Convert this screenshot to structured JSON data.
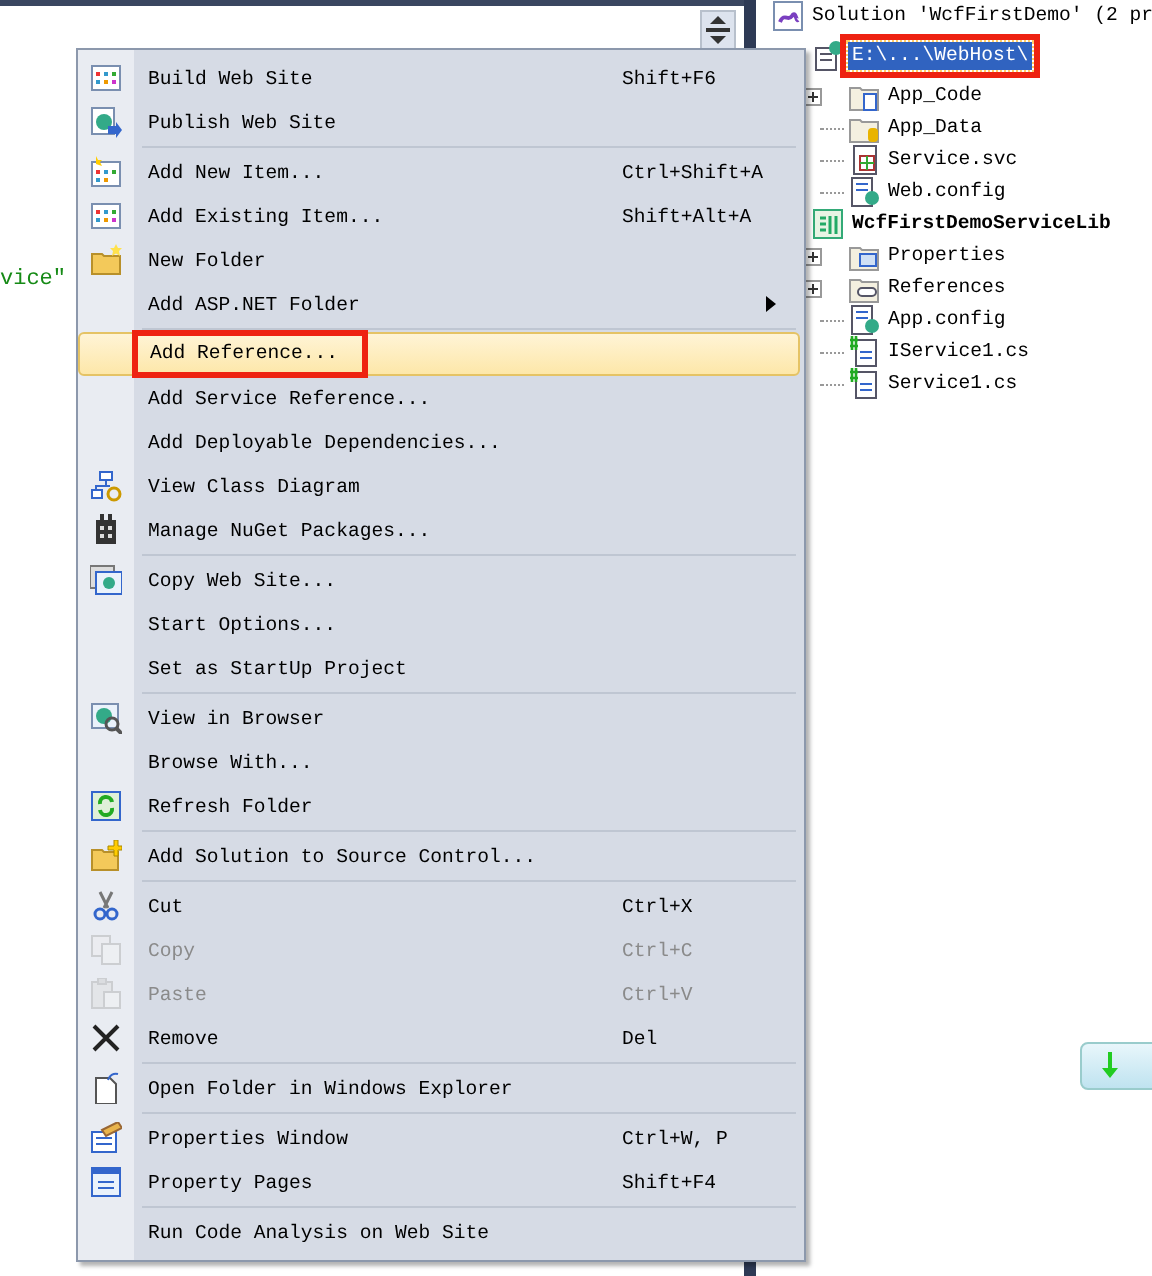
{
  "editor": {
    "code_fragment": "vice\""
  },
  "context_menu": {
    "groups": [
      [
        {
          "label": "Build Web Site",
          "shortcut": "Shift+F6",
          "disabled": false,
          "selected": false
        },
        {
          "label": "Publish Web Site",
          "disabled": false,
          "selected": false
        }
      ],
      [
        {
          "label": "Add New Item...",
          "shortcut": "Ctrl+Shift+A",
          "disabled": false,
          "selected": false
        },
        {
          "label": "Add Existing Item...",
          "shortcut": "Shift+Alt+A",
          "disabled": false,
          "selected": false
        },
        {
          "label": "New Folder",
          "disabled": false,
          "selected": false
        },
        {
          "label": "Add ASP.NET Folder",
          "disabled": false,
          "selected": false,
          "submenu": true
        }
      ],
      [
        {
          "label": "Add Reference...",
          "disabled": false,
          "selected": true,
          "annotated": true
        },
        {
          "label": "Add Service Reference...",
          "disabled": false,
          "selected": false
        },
        {
          "label": "Add Deployable Dependencies...",
          "disabled": false,
          "selected": false
        },
        {
          "label": "View Class Diagram",
          "disabled": false,
          "selected": false
        },
        {
          "label": "Manage NuGet Packages...",
          "disabled": false,
          "selected": false
        }
      ],
      [
        {
          "label": "Copy Web Site...",
          "disabled": false,
          "selected": false
        },
        {
          "label": "Start Options...",
          "disabled": false,
          "selected": false
        },
        {
          "label": "Set as StartUp Project",
          "disabled": false,
          "selected": false
        }
      ],
      [
        {
          "label": "View in Browser",
          "disabled": false,
          "selected": false
        },
        {
          "label": "Browse With...",
          "disabled": false,
          "selected": false
        },
        {
          "label": "Refresh Folder",
          "disabled": false,
          "selected": false
        }
      ],
      [
        {
          "label": "Add Solution to Source Control...",
          "disabled": false,
          "selected": false
        }
      ],
      [
        {
          "label": "Cut",
          "shortcut": "Ctrl+X",
          "disabled": false,
          "selected": false
        },
        {
          "label": "Copy",
          "shortcut": "Ctrl+C",
          "disabled": true,
          "selected": false
        },
        {
          "label": "Paste",
          "shortcut": "Ctrl+V",
          "disabled": true,
          "selected": false
        },
        {
          "label": "Remove",
          "shortcut": "Del",
          "disabled": false,
          "selected": false
        }
      ],
      [
        {
          "label": "Open Folder in Windows Explorer",
          "disabled": false,
          "selected": false
        }
      ],
      [
        {
          "label": "Properties Window",
          "shortcut": "Ctrl+W, P",
          "disabled": false,
          "selected": false
        },
        {
          "label": "Property Pages",
          "shortcut": "Shift+F4",
          "disabled": false,
          "selected": false
        }
      ],
      [
        {
          "label": "Run Code Analysis on Web Site",
          "disabled": false,
          "selected": false
        }
      ]
    ]
  },
  "solution_explorer": {
    "tree": [
      {
        "label": "Solution 'WcfFirstDemo' (2 pr",
        "bold": false,
        "selected": false,
        "children": [
          {
            "label": "E:\\...\\WebHost\\",
            "bold": false,
            "selected": true,
            "annotated": true,
            "children": [
              {
                "label": "App_Code",
                "bold": false,
                "selected": false,
                "expanded": false
              },
              {
                "label": "App_Data",
                "bold": false,
                "selected": false
              },
              {
                "label": "Service.svc",
                "bold": false,
                "selected": false
              },
              {
                "label": "Web.config",
                "bold": false,
                "selected": false
              }
            ]
          },
          {
            "label": "WcfFirstDemoServiceLib",
            "bold": true,
            "selected": false,
            "children": [
              {
                "label": "Properties",
                "bold": false,
                "selected": false,
                "expanded": false
              },
              {
                "label": "References",
                "bold": false,
                "selected": false,
                "expanded": false
              },
              {
                "label": "App.config",
                "bold": false,
                "selected": false
              },
              {
                "label": "IService1.cs",
                "bold": false,
                "selected": false
              },
              {
                "label": "Service1.cs",
                "bold": false,
                "selected": false
              }
            ]
          }
        ]
      }
    ]
  }
}
